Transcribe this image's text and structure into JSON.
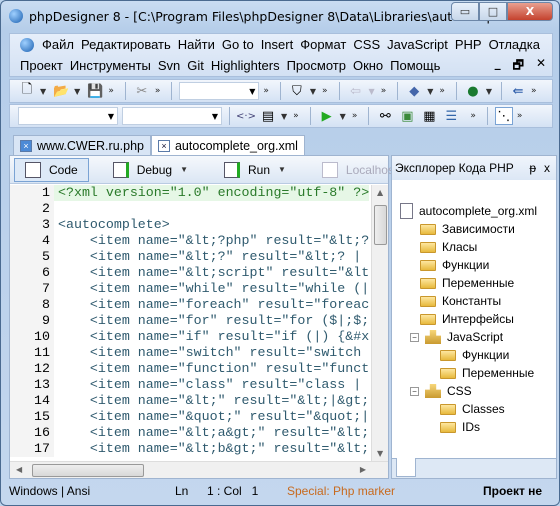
{
  "window": {
    "title": "phpDesigner 8 - [C:\\Program Files\\phpDesigner 8\\Data\\Libraries\\autocomple...",
    "minimize": "▭",
    "maximize": "□",
    "close": "X"
  },
  "menu": {
    "row1": [
      "Файл",
      "Редактировать",
      "Найти",
      "Go to",
      "Insert",
      "Формат",
      "CSS",
      "JavaScript",
      "PHP",
      "Отладка"
    ],
    "row2": [
      "Проект",
      "Инструменты",
      "Svn",
      "Git",
      "Highlighters",
      "Просмотр",
      "Окно",
      "Помощь"
    ],
    "mdi": [
      "_",
      "🗗",
      "✕"
    ]
  },
  "tabs": [
    {
      "label": "www.CWER.ru.php",
      "active": false
    },
    {
      "label": "autocomplete_org.xml",
      "active": true
    }
  ],
  "code_toolbar": {
    "code": "Code",
    "debug": "Debug",
    "run": "Run",
    "localhost": "Localhost"
  },
  "editor": {
    "lines": [
      "<?xml version=\"1.0\" encoding=\"utf-8\" ?>",
      "",
      "<autocomplete>",
      "    <item name=\"&lt;?php\" result=\"&lt;?",
      "    <item name=\"&lt;?\" result=\"&lt;? |",
      "    <item name=\"&lt;script\" result=\"&lt",
      "    <item name=\"while\" result=\"while (|",
      "    <item name=\"foreach\" result=\"foreac",
      "    <item name=\"for\" result=\"for ($|;$;",
      "    <item name=\"if\" result=\"if (|) {&#x",
      "    <item name=\"switch\" result=\"switch ",
      "    <item name=\"function\" result=\"funct",
      "    <item name=\"class\" result=\"class | ",
      "    <item name=\"&lt;\" result=\"&lt;|&gt;",
      "    <item name=\"&quot;\" result=\"&quot;|",
      "    <item name=\"&lt;a&gt;\" result=\"&lt;",
      "    <item name=\"&lt;b&gt;\" result=\"&lt;"
    ]
  },
  "explorer": {
    "title": "Эксплорер Кода PHP",
    "pin": "ᵽ",
    "close": "x",
    "tree": [
      {
        "label": "autocomplete_org.xml",
        "type": "file",
        "level": 0
      },
      {
        "label": "Зависимости",
        "type": "folder",
        "level": 1
      },
      {
        "label": "Класы",
        "type": "folder",
        "level": 1
      },
      {
        "label": "Функции",
        "type": "folder",
        "level": 1
      },
      {
        "label": "Переменные",
        "type": "folder",
        "level": 1
      },
      {
        "label": "Константы",
        "type": "folder",
        "level": 1
      },
      {
        "label": "Интерфейсы",
        "type": "folder",
        "level": 1
      },
      {
        "label": "JavaScript",
        "type": "namespace",
        "level": 1
      },
      {
        "label": "Функции",
        "type": "folder",
        "level": 2
      },
      {
        "label": "Переменные",
        "type": "folder",
        "level": 2
      },
      {
        "label": "CSS",
        "type": "namespace",
        "level": 1
      },
      {
        "label": "Classes",
        "type": "folder",
        "level": 2
      },
      {
        "label": "IDs",
        "type": "folder",
        "level": 2
      }
    ]
  },
  "status": {
    "encoding": "Windows | Ansi",
    "ln_label": "Ln",
    "position": "1 : Col   1",
    "special": "Special: Php marker",
    "project": "Проект не"
  },
  "colors": {
    "special": "#c86a1e",
    "accent": "#3b5c8c"
  }
}
